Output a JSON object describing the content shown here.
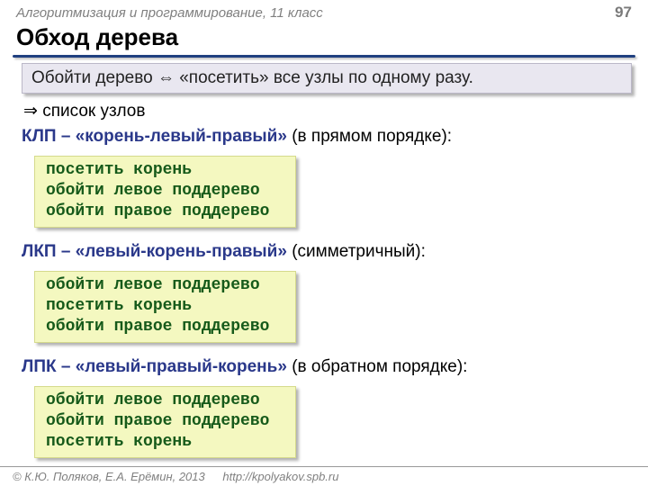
{
  "header": {
    "course": "Алгоритмизация и программирование, 11 класс",
    "page": "97"
  },
  "title": "Обход дерева",
  "definition": "Обойти дерево ⇔ «посетить» все узлы по одному разу.",
  "arrow": "⇒ список узлов",
  "methods": [
    {
      "abbr": "КЛП",
      "name": "«корень-левый-правый»",
      "note": "(в прямом порядке):",
      "code": [
        "посетить корень",
        "обойти левое поддерево",
        "обойти правое поддерево"
      ]
    },
    {
      "abbr": "ЛКП",
      "name": "«левый-корень-правый»",
      "note": "(симметричный):",
      "code": [
        "обойти левое поддерево",
        "посетить корень",
        "обойти правое поддерево"
      ]
    },
    {
      "abbr": "ЛПК",
      "name": "«левый-правый-корень»",
      "note": "(в обратном порядке):",
      "code": [
        "обойти левое поддерево",
        "обойти правое поддерево",
        "посетить корень"
      ]
    }
  ],
  "footer": {
    "author": "© К.Ю. Поляков, Е.А. Ерёмин, 2013",
    "link": "http://kpolyakov.spb.ru"
  }
}
